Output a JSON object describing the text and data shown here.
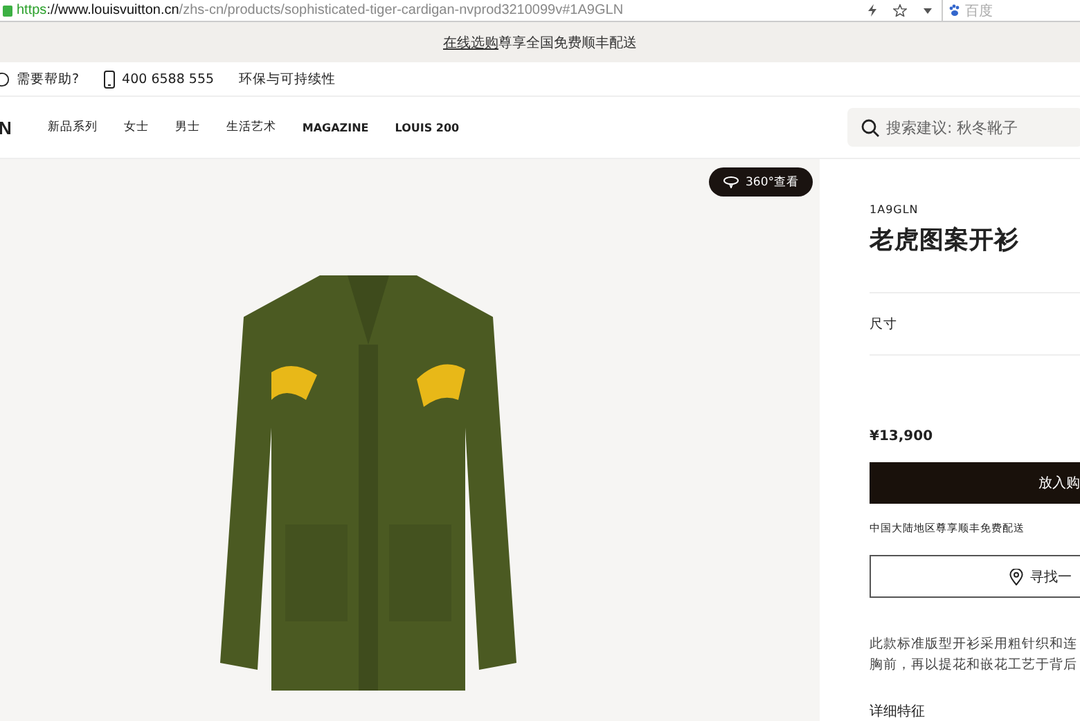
{
  "browser": {
    "url_scheme": "https",
    "url_host": "://www.louisvuitton.cn",
    "url_path": "/zhs-cn/products/sophisticated-tiger-cardigan-nvprod3210099v#1A9GLN",
    "search_engine": "百度"
  },
  "banner": {
    "link": "在线选购",
    "text": " 尊享全国免费顺丰配送"
  },
  "utility": {
    "help": "需要帮助?",
    "phone": "400 6588 555",
    "sustainability": "环保与可持续性"
  },
  "nav": {
    "logo": "N",
    "items": [
      "新品系列",
      "女士",
      "男士",
      "生活艺术",
      "MAGAZINE",
      "LOUIS 200"
    ],
    "search": {
      "placeholder": "搜索建议: 秋冬靴子"
    }
  },
  "gallery": {
    "view360": "360°查看"
  },
  "product": {
    "sku": "1A9GLN",
    "title": "老虎图案开衫",
    "size_label": "尺寸",
    "price": "¥13,900",
    "add_to_cart": "放入购",
    "shipping": "中国大陆地区尊享顺丰免费配送",
    "find_store": "寻找一",
    "description": [
      "此款标准版型开衫采用粗针织和连",
      "胸前，再以提花和嵌花工艺于背后"
    ],
    "details_heading": "详细特征"
  }
}
